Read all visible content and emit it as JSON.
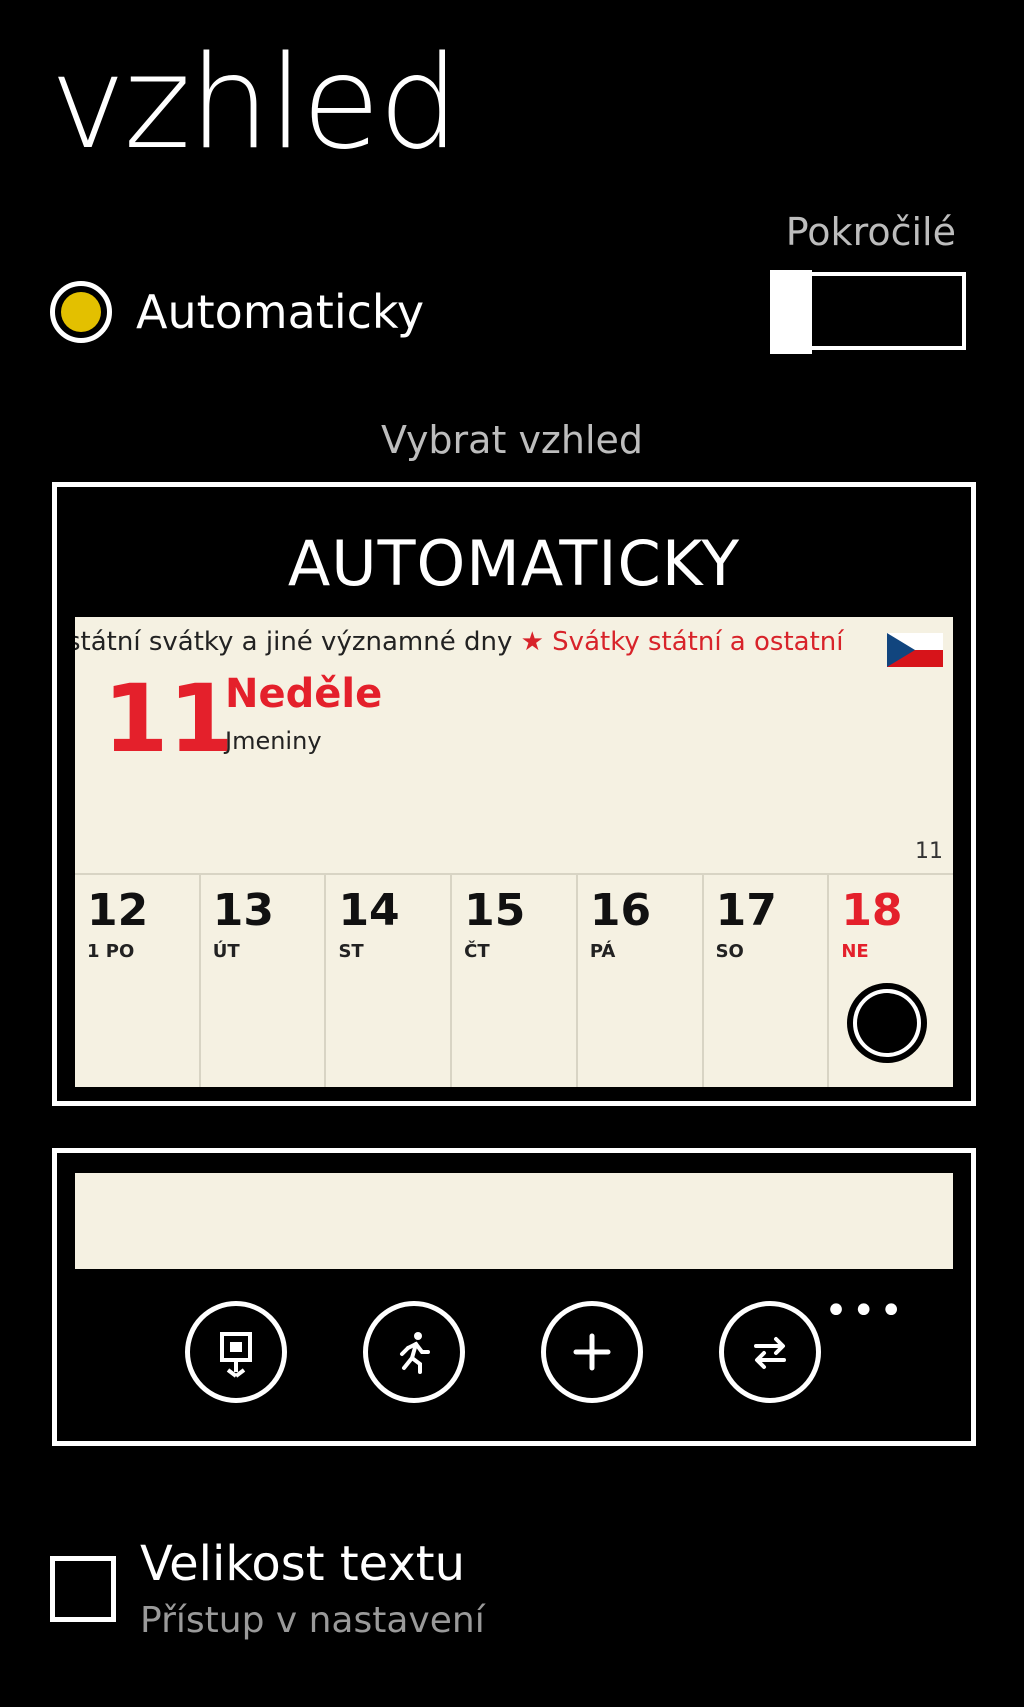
{
  "page": {
    "title": "vzhled"
  },
  "advanced": {
    "label": "Pokročilé",
    "toggle_on": false
  },
  "appearance_mode": {
    "label": "Automaticky",
    "selected": true,
    "accent": "#e3c000"
  },
  "select_label": "Vybrat vzhled",
  "preview": {
    "heading": "AUTOMATICKY",
    "calendar": {
      "header_text": "státní svátky a jiné významné dny",
      "header_star": "★",
      "header_red_text": "Svátky státní a ostatní",
      "flag_icon": "czech-flag-icon",
      "day_number": "11",
      "day_name": "Neděle",
      "day_sub": "Jmeniny",
      "corner_number": "11",
      "week": [
        {
          "num": "12",
          "dow": "1 PO"
        },
        {
          "num": "13",
          "dow": "ÚT"
        },
        {
          "num": "14",
          "dow": "ST"
        },
        {
          "num": "15",
          "dow": "ČT"
        },
        {
          "num": "16",
          "dow": "PÁ"
        },
        {
          "num": "17",
          "dow": "SO"
        },
        {
          "num": "18",
          "dow": "NE"
        }
      ],
      "highlight_color": "#e4202b"
    }
  },
  "toolbar": {
    "buttons": [
      {
        "icon": "presentation-icon"
      },
      {
        "icon": "running-man-icon"
      },
      {
        "icon": "add-icon"
      },
      {
        "icon": "swap-icon"
      }
    ],
    "more_label": "•••"
  },
  "text_size": {
    "title": "Velikost textu",
    "subtitle": "Přístup v nastavení",
    "checked": false
  }
}
